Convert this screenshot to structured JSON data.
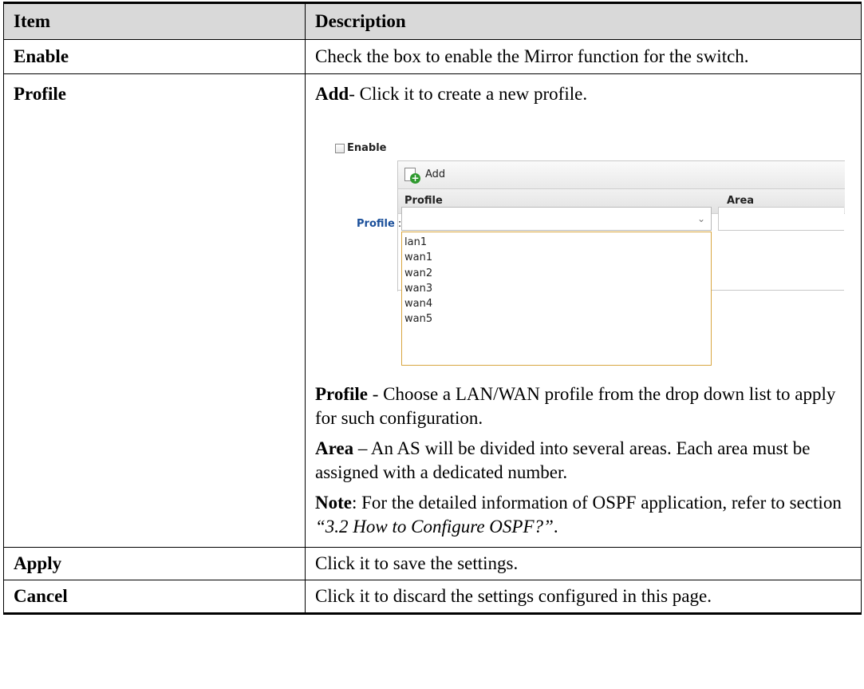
{
  "table": {
    "header": {
      "item": "Item",
      "description": "Description"
    },
    "rows": {
      "enable": {
        "name": "Enable",
        "desc": "Check the box to enable the Mirror function for the switch."
      },
      "profile": {
        "name": "Profile",
        "add_bold": "Add",
        "add_text": "- Click it to create a new profile.",
        "profile_bold": "Profile",
        "profile_text": " - Choose a LAN/WAN profile from the drop down list to apply for such configuration.",
        "area_bold": "Area",
        "area_text": " – An AS will be divided into several areas. Each area must be assigned with a dedicated number.",
        "note_bold": "Note",
        "note_text": ": For the detailed information of OSPF application, refer to section ",
        "note_ref": "“3.2 How to Configure OSPF?”",
        "note_end": "."
      },
      "apply": {
        "name": "Apply",
        "desc": "Click it to save the settings."
      },
      "cancel": {
        "name": "Cancel",
        "desc": "Click it to discard the settings configured in this page."
      }
    }
  },
  "screenshot": {
    "enable_label": "Enable",
    "add_button": "Add",
    "col_profile": "Profile",
    "col_area": "Area",
    "profile_label": "Profile",
    "profile_colon": " :",
    "options": [
      "lan1",
      "wan1",
      "wan2",
      "wan3",
      "wan4",
      "wan5"
    ]
  }
}
